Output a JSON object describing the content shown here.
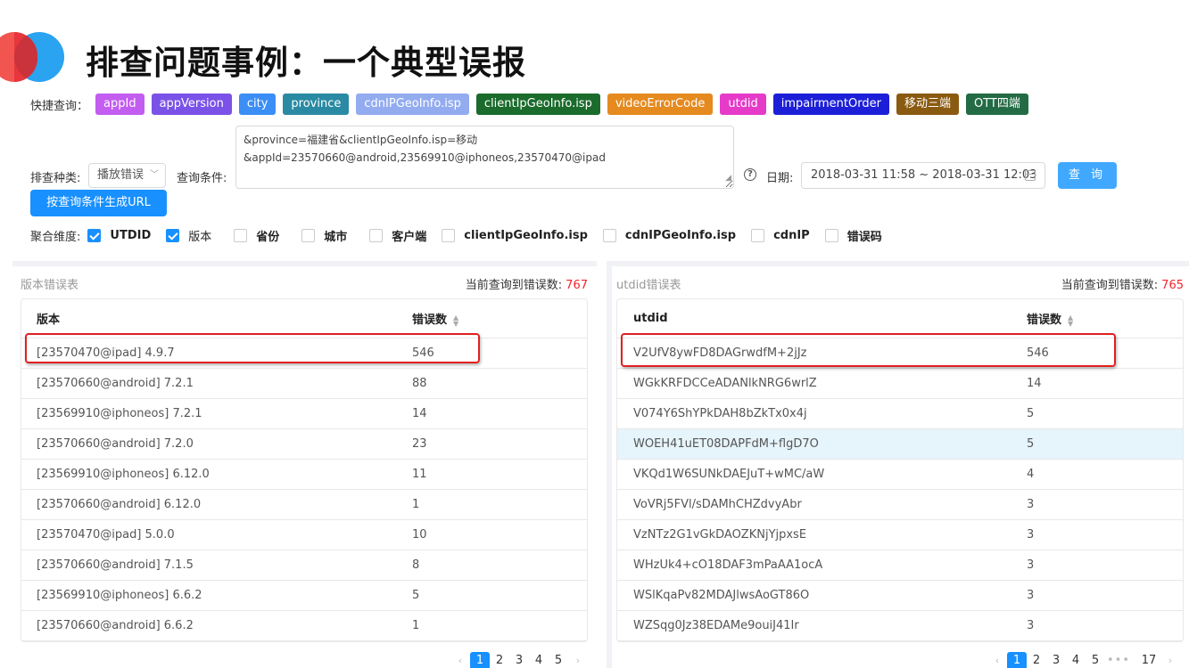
{
  "title": "排查问题事例：一个典型误报",
  "quick_query": {
    "label": "快捷查询：",
    "tags": [
      {
        "label": "appId",
        "color": "#c35cf0"
      },
      {
        "label": "appVersion",
        "color": "#7b52e8"
      },
      {
        "label": "city",
        "color": "#3b8ef5"
      },
      {
        "label": "province",
        "color": "#2b8aa3"
      },
      {
        "label": "cdnIPGeoInfo.isp",
        "color": "#93acf0"
      },
      {
        "label": "clientIpGeoInfo.isp",
        "color": "#1a6b2c"
      },
      {
        "label": "videoErrorCode",
        "color": "#e58a1f"
      },
      {
        "label": "utdid",
        "color": "#e63ac9"
      },
      {
        "label": "impairmentOrder",
        "color": "#1d1fd8"
      },
      {
        "label": "移动三端",
        "color": "#8a5a10"
      },
      {
        "label": "OTT四端",
        "color": "#236b45"
      }
    ]
  },
  "filters": {
    "type_label": "排查种类:",
    "type_value": "播放错误",
    "condition_label": "查询条件:",
    "condition_line1": "&province=福建省&clientIpGeoInfo.isp=移动",
    "condition_line2": "&appId=23570660@android,23569910@iphoneos,23570470@ipad",
    "date_label": "日期:",
    "date_value": "2018-03-31 11:58 ~ 2018-03-31 12:03",
    "query_button": "查 询",
    "url_button": "按查询条件生成URL"
  },
  "dimensions": {
    "label": "聚合维度:",
    "items": [
      {
        "label": "UTDID",
        "checked": true
      },
      {
        "label": "版本",
        "checked": true
      },
      {
        "label": "省份",
        "checked": false
      },
      {
        "label": "城市",
        "checked": false
      },
      {
        "label": "客户端",
        "checked": false
      },
      {
        "label": "clientIpGeoInfo.isp",
        "checked": false
      },
      {
        "label": "cdnIPGeoInfo.isp",
        "checked": false
      },
      {
        "label": "cdnIP",
        "checked": false
      },
      {
        "label": "错误码",
        "checked": false
      }
    ]
  },
  "version_table": {
    "caption": "版本错误表",
    "count_label": "当前查询到错误数:",
    "count": "767",
    "col1": "版本",
    "col2": "错误数",
    "rows": [
      [
        "[23570470@ipad] 4.9.7",
        "546"
      ],
      [
        "[23570660@android] 7.2.1",
        "88"
      ],
      [
        "[23569910@iphoneos] 7.2.1",
        "14"
      ],
      [
        "[23570660@android] 7.2.0",
        "23"
      ],
      [
        "[23569910@iphoneos] 6.12.0",
        "11"
      ],
      [
        "[23570660@android] 6.12.0",
        "1"
      ],
      [
        "[23570470@ipad] 5.0.0",
        "10"
      ],
      [
        "[23570660@android] 7.1.5",
        "8"
      ],
      [
        "[23569910@iphoneos] 6.6.2",
        "5"
      ],
      [
        "[23570660@android] 6.6.2",
        "1"
      ]
    ],
    "pages": [
      "1",
      "2",
      "3",
      "4",
      "5"
    ]
  },
  "utdid_table": {
    "caption": "utdid错误表",
    "count_label": "当前查询到错误数:",
    "count": "765",
    "col1": "utdid",
    "col2": "错误数",
    "rows": [
      [
        "V2UfV8ywFD8DAGrwdfM+2jJz",
        "546"
      ],
      [
        "WGkKRFDCCeADANlkNRG6wrlZ",
        "14"
      ],
      [
        "V074Y6ShYPkDAH8bZkTx0x4j",
        "5"
      ],
      [
        "WOEH41uET08DAPFdM+flgD7O",
        "5"
      ],
      [
        "VKQd1W6SUNkDAEJuT+wMC/aW",
        "4"
      ],
      [
        "VoVRj5FVl/sDAMhCHZdvyAbr",
        "3"
      ],
      [
        "VzNTz2G1vGkDAOZKNjYjpxsE",
        "3"
      ],
      [
        "WHzUk4+cO18DAF3mPaAA1ocA",
        "3"
      ],
      [
        "WSlKqaPv82MDAJlwsAoGT86O",
        "3"
      ],
      [
        "WZSqg0Jz38EDAMe9ouiJ41Ir",
        "3"
      ]
    ],
    "pages": [
      "1",
      "2",
      "3",
      "4",
      "5",
      "17"
    ]
  }
}
